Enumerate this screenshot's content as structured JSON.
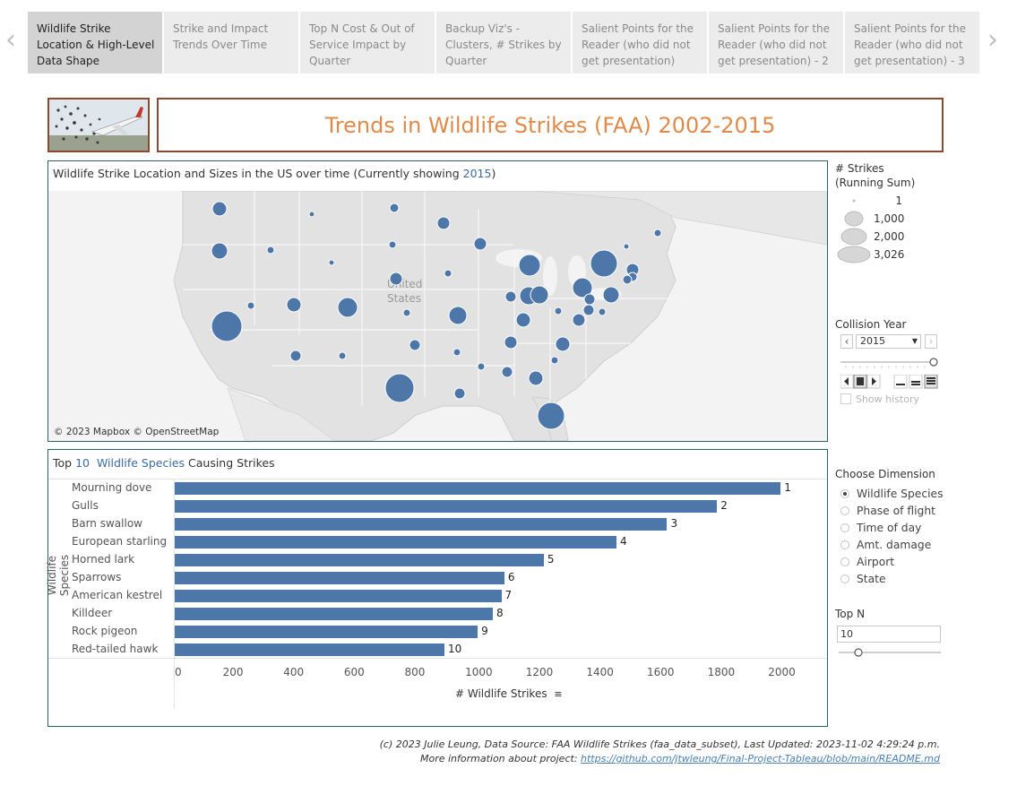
{
  "story": {
    "tabs": [
      "Wildlife Strike Location & High-Level Data Shape",
      "Strike and Impact Trends Over Time",
      "Top N Cost & Out of Service Impact by Quarter",
      "Backup Viz's - Clusters, # Strikes by Quarter",
      "Salient Points for the Reader (who did not get presentation)",
      "Salient Points for the Reader (who did not get presentation) - 2",
      "Salient Points for the Reader (who did not get presentation) - 3"
    ],
    "prev_arrow": "‹",
    "next_arrow": "›"
  },
  "header": {
    "title": "Trends in Wildlife Strikes (FAA) 2002-2015"
  },
  "map": {
    "title_prefix": "Wildlife Strike Location and Sizes in the US over time (Currently showing ",
    "title_year": "2015",
    "title_suffix": ")",
    "country_label_1": "United",
    "country_label_2": "States",
    "attribution": "© 2023 Mapbox © OpenStreetMap",
    "bubble_color": "#4e77a9"
  },
  "legend": {
    "title_line1": "# Strikes",
    "title_line2": "(Running Sum)",
    "items": [
      "1",
      "1,000",
      "2,000",
      "3,026"
    ]
  },
  "collision_year": {
    "label": "Collision Year",
    "value": "2015",
    "show_history": "Show history"
  },
  "dimension": {
    "label": "Choose Dimension",
    "options": [
      "Wildlife Species",
      "Phase of flight",
      "Time of day",
      "Amt. damage",
      "Airport",
      "State"
    ],
    "selected": "Wildlife Species"
  },
  "top_n": {
    "label": "Top N",
    "value": "10"
  },
  "bar_panel": {
    "title_prefix": "Top ",
    "title_n": "10",
    "title_dimension": "Wildlife Species",
    "title_suffix": " Causing Strikes"
  },
  "chart_data": {
    "type": "bar",
    "orientation": "horizontal",
    "categories": [
      "Mourning dove",
      "Gulls",
      "Barn swallow",
      "European starling",
      "Horned lark",
      "Sparrows",
      "American kestrel",
      "Killdeer",
      "Rock pigeon",
      "Red-tailed hawk"
    ],
    "values": [
      2000,
      1790,
      1625,
      1458,
      1218,
      1088,
      1078,
      1050,
      1000,
      890
    ],
    "rank_labels": [
      "1",
      "2",
      "3",
      "4",
      "5",
      "6",
      "7",
      "8",
      "9",
      "10"
    ],
    "xlabel": "# Wildlife Strikes",
    "ylabel": "Wildlife Species",
    "xlim": [
      0,
      2150
    ],
    "xticks": [
      0,
      200,
      400,
      600,
      800,
      1000,
      1200,
      1400,
      1600,
      1800,
      2000
    ],
    "bar_color": "#4e77a9"
  },
  "footer": {
    "line1": "(c) 2023 Julie Leung, Data Source: FAA Wildlife Strikes (faa_data_subset), Last Updated: 2023-11-02 4:29:24 p.m.",
    "line2_prefix": "More information about project: ",
    "link": "https://github.com/jtwleung/Final-Project-Tableau/blob/main/README.md"
  }
}
